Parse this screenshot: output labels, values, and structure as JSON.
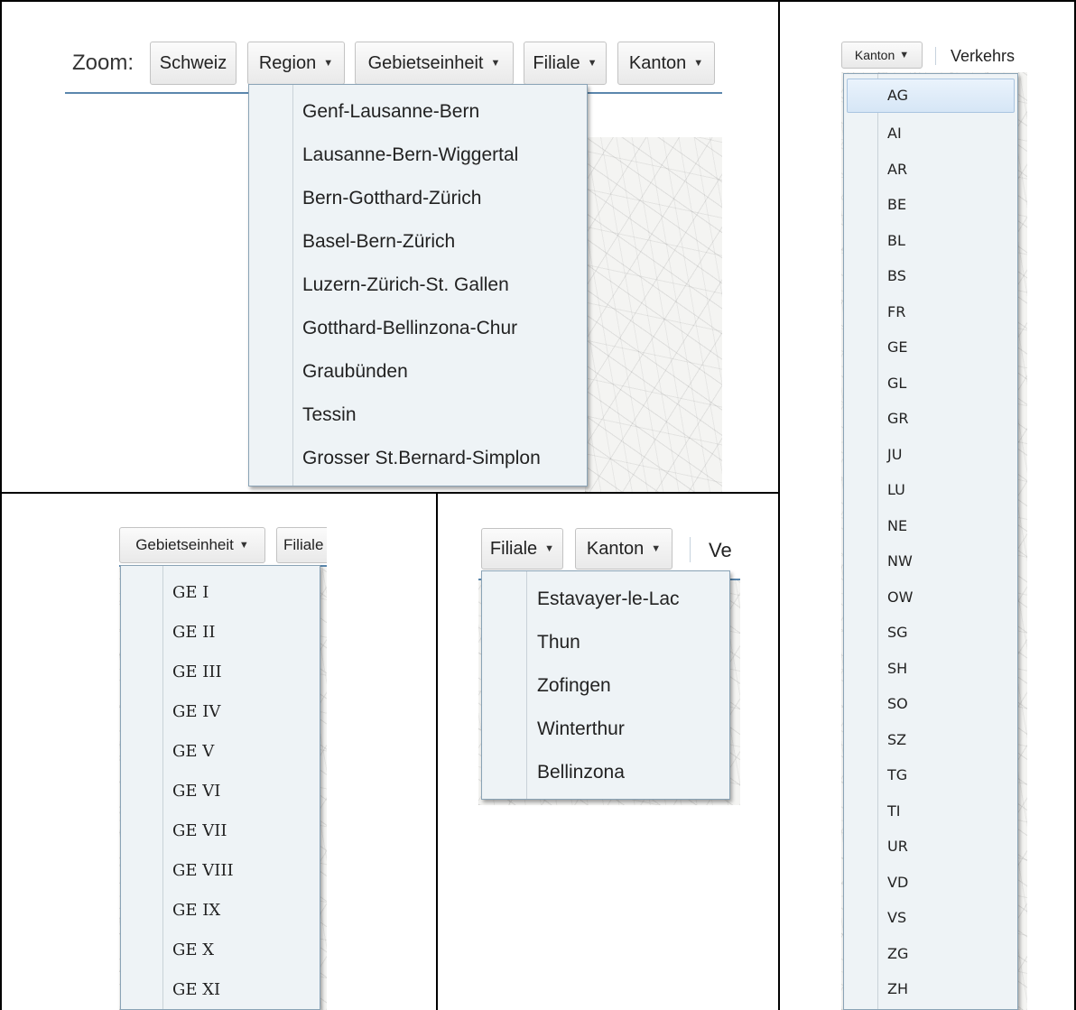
{
  "top_left_panel": {
    "zoom_label": "Zoom:",
    "buttons": {
      "schweiz": "Schweiz",
      "region": "Region",
      "gebietseinheit": "Gebietseinheit",
      "filiale": "Filiale",
      "kanton": "Kanton"
    },
    "region_menu": [
      "Genf-Lausanne-Bern",
      "Lausanne-Bern-Wiggertal",
      "Bern-Gotthard-Zürich",
      "Basel-Bern-Zürich",
      "Luzern-Zürich-St. Gallen",
      "Gotthard-Bellinzona-Chur",
      "Graubünden",
      "Tessin",
      "Grosser St.Bernard-Simplon"
    ]
  },
  "bottom_left_panel": {
    "buttons": {
      "gebietseinheit": "Gebietseinheit",
      "filiale": "Filiale"
    },
    "gebietseinheit_menu": [
      "GE I",
      "GE II",
      "GE III",
      "GE IV",
      "GE V",
      "GE VI",
      "GE VII",
      "GE VIII",
      "GE IX",
      "GE X",
      "GE XI"
    ]
  },
  "bottom_middle_panel": {
    "buttons": {
      "filiale": "Filiale",
      "kanton": "Kanton"
    },
    "truncated_text": "Ve",
    "filiale_menu": [
      "Estavayer-le-Lac",
      "Thun",
      "Zofingen",
      "Winterthur",
      "Bellinzona"
    ]
  },
  "right_panel": {
    "buttons": {
      "kanton": "Kanton"
    },
    "truncated_text": "Verkehrs",
    "selected_item": "AG",
    "kanton_menu": [
      "AG",
      "AI",
      "AR",
      "BE",
      "BL",
      "BS",
      "FR",
      "GE",
      "GL",
      "GR",
      "JU",
      "LU",
      "NE",
      "NW",
      "OW",
      "SG",
      "SH",
      "SO",
      "SZ",
      "TG",
      "TI",
      "UR",
      "VD",
      "VS",
      "ZG",
      "ZH"
    ]
  },
  "icons": {
    "caret": "dropdown-caret-icon"
  },
  "colors": {
    "toolbar_line": "#5b87ad",
    "menu_bg": "#eef3f6",
    "menu_border": "#8aa3b6",
    "selected_bg": "#d6e6f6"
  }
}
